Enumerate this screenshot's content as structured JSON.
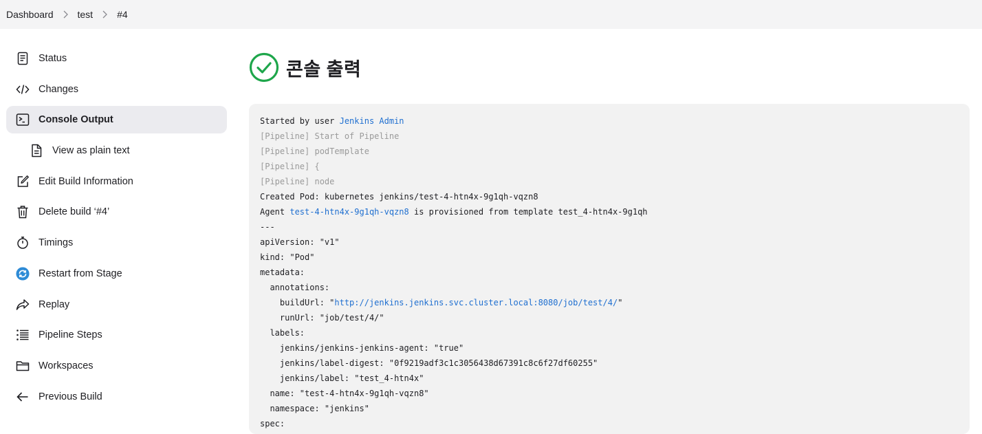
{
  "breadcrumb": {
    "items": [
      "Dashboard",
      "test",
      "#4"
    ]
  },
  "sidebar": {
    "items": [
      {
        "label": "Status",
        "icon": "document-icon"
      },
      {
        "label": "Changes",
        "icon": "code-icon"
      },
      {
        "label": "Console Output",
        "icon": "terminal-icon",
        "active": true
      },
      {
        "label": "View as plain text",
        "icon": "file-text-icon",
        "sub": true
      },
      {
        "label": "Edit Build Information",
        "icon": "edit-icon"
      },
      {
        "label": "Delete build ‘#4’",
        "icon": "trash-icon"
      },
      {
        "label": "Timings",
        "icon": "stopwatch-icon"
      },
      {
        "label": "Restart from Stage",
        "icon": "restart-icon"
      },
      {
        "label": "Replay",
        "icon": "share-icon"
      },
      {
        "label": "Pipeline Steps",
        "icon": "list-icon"
      },
      {
        "label": "Workspaces",
        "icon": "folder-icon"
      },
      {
        "label": "Previous Build",
        "icon": "arrow-left-icon"
      }
    ]
  },
  "page": {
    "title": "콘솔 출력",
    "status_icon": "success-check-icon",
    "status_color": "#1ea64b"
  },
  "console": {
    "lines": [
      {
        "parts": [
          {
            "text": "Started by user "
          },
          {
            "text": "Jenkins Admin",
            "link": true
          }
        ]
      },
      {
        "parts": [
          {
            "text": "[Pipeline] Start of Pipeline"
          }
        ],
        "pipeline": true
      },
      {
        "parts": [
          {
            "text": "[Pipeline] podTemplate"
          }
        ],
        "pipeline": true
      },
      {
        "parts": [
          {
            "text": "[Pipeline] {"
          }
        ],
        "pipeline": true
      },
      {
        "parts": [
          {
            "text": "[Pipeline] node"
          }
        ],
        "pipeline": true
      },
      {
        "parts": [
          {
            "text": "Created Pod: kubernetes jenkins/test-4-htn4x-9g1qh-vqzn8"
          }
        ]
      },
      {
        "parts": [
          {
            "text": "Agent "
          },
          {
            "text": "test-4-htn4x-9g1qh-vqzn8",
            "link": true
          },
          {
            "text": " is provisioned from template test_4-htn4x-9g1qh"
          }
        ]
      },
      {
        "parts": [
          {
            "text": "---"
          }
        ]
      },
      {
        "parts": [
          {
            "text": "apiVersion: \"v1\""
          }
        ]
      },
      {
        "parts": [
          {
            "text": "kind: \"Pod\""
          }
        ]
      },
      {
        "parts": [
          {
            "text": "metadata:"
          }
        ]
      },
      {
        "parts": [
          {
            "text": "  annotations:"
          }
        ]
      },
      {
        "parts": [
          {
            "text": "    buildUrl: \""
          },
          {
            "text": "http://jenkins.jenkins.svc.cluster.local:8080/job/test/4/",
            "link": true
          },
          {
            "text": "\""
          }
        ]
      },
      {
        "parts": [
          {
            "text": "    runUrl: \"job/test/4/\""
          }
        ]
      },
      {
        "parts": [
          {
            "text": "  labels:"
          }
        ]
      },
      {
        "parts": [
          {
            "text": "    jenkins/jenkins-jenkins-agent: \"true\""
          }
        ]
      },
      {
        "parts": [
          {
            "text": "    jenkins/label-digest: \"0f9219adf3c1c3056438d67391c8c6f27df60255\""
          }
        ]
      },
      {
        "parts": [
          {
            "text": "    jenkins/label: \"test_4-htn4x\""
          }
        ]
      },
      {
        "parts": [
          {
            "text": "  name: \"test-4-htn4x-9g1qh-vqzn8\""
          }
        ]
      },
      {
        "parts": [
          {
            "text": "  namespace: \"jenkins\""
          }
        ]
      },
      {
        "parts": [
          {
            "text": "spec:"
          }
        ]
      }
    ]
  },
  "colors": {
    "link": "#1f6fd0",
    "pipeline_text": "#9a9a9a",
    "active_bg": "#ebebef",
    "console_bg": "#f2f2f2"
  }
}
